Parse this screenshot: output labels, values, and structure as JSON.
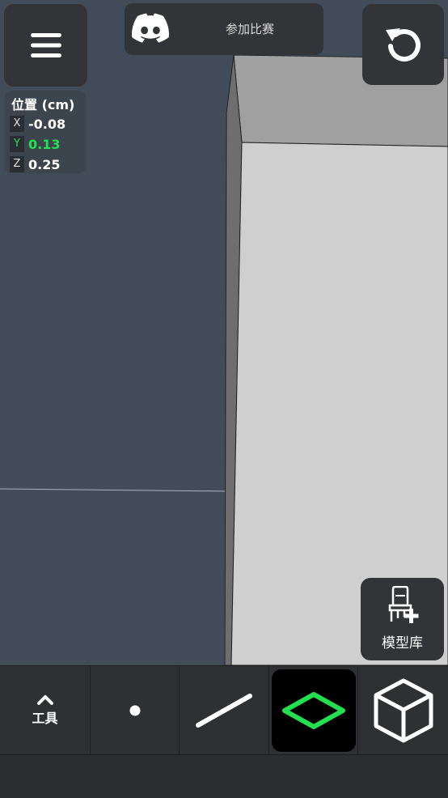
{
  "discord": {
    "label": "参加比赛"
  },
  "position": {
    "title": "位置 (cm)",
    "x": {
      "axis": "X",
      "value": "-0.08"
    },
    "y": {
      "axis": "Y",
      "value": "0.13",
      "color": "#22e04f"
    },
    "z": {
      "axis": "Z",
      "value": "0.25"
    }
  },
  "library": {
    "label": "模型库"
  },
  "toolbar": {
    "tools_label": "工具",
    "active_tool": "plane",
    "active_color": "#22e04f",
    "icons": [
      "chevron-up-icon",
      "point-icon",
      "line-icon",
      "plane-icon",
      "cube-icon"
    ]
  },
  "colors": {
    "background": "#424c58",
    "panel": "#333437",
    "accent": "#22e04f"
  }
}
